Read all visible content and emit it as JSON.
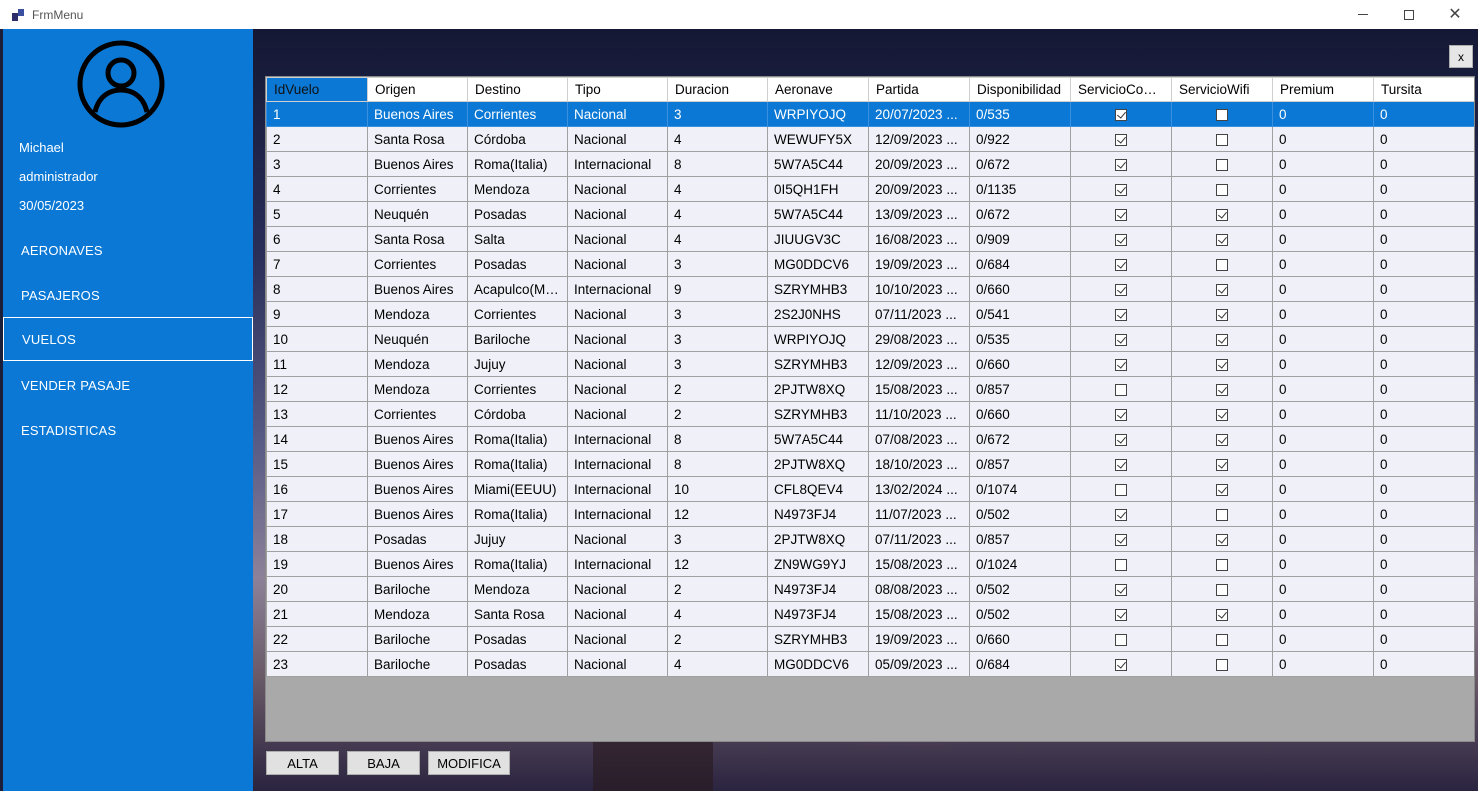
{
  "window": {
    "title": "FrmMenu"
  },
  "user": {
    "name": "Michael",
    "role": "administrador",
    "date": "30/05/2023"
  },
  "nav": [
    {
      "label": "AERONAVES",
      "active": false
    },
    {
      "label": "PASAJEROS",
      "active": false
    },
    {
      "label": "VUELOS",
      "active": true
    },
    {
      "label": "VENDER PASAJE",
      "active": false
    },
    {
      "label": "ESTADISTICAS",
      "active": false
    }
  ],
  "content": {
    "close_label": "x"
  },
  "grid": {
    "columns": [
      "IdVuelo",
      "Origen",
      "Destino",
      "Tipo",
      "Duracion",
      "Aeronave",
      "Partida",
      "Disponibilidad",
      "ServicioComida",
      "ServicioWifi",
      "Premium",
      "Tursita"
    ],
    "selected_row": 0,
    "rows": [
      [
        "1",
        "Buenos Aires",
        "Corrientes",
        "Nacional",
        "3",
        "WRPIYOJQ",
        "20/07/2023 ...",
        "0/535",
        true,
        false,
        "0",
        "0"
      ],
      [
        "2",
        "Santa Rosa",
        "Córdoba",
        "Nacional",
        "4",
        "WEWUFY5X",
        "12/09/2023 ...",
        "0/922",
        true,
        false,
        "0",
        "0"
      ],
      [
        "3",
        "Buenos Aires",
        "Roma(Italia)",
        "Internacional",
        "8",
        "5W7A5C44",
        "20/09/2023 ...",
        "0/672",
        true,
        false,
        "0",
        "0"
      ],
      [
        "4",
        "Corrientes",
        "Mendoza",
        "Nacional",
        "4",
        "0I5QH1FH",
        "20/09/2023 ...",
        "0/1135",
        true,
        false,
        "0",
        "0"
      ],
      [
        "5",
        "Neuquén",
        "Posadas",
        "Nacional",
        "4",
        "5W7A5C44",
        "13/09/2023 ...",
        "0/672",
        true,
        true,
        "0",
        "0"
      ],
      [
        "6",
        "Santa Rosa",
        "Salta",
        "Nacional",
        "4",
        "JIUUGV3C",
        "16/08/2023 ...",
        "0/909",
        true,
        true,
        "0",
        "0"
      ],
      [
        "7",
        "Corrientes",
        "Posadas",
        "Nacional",
        "3",
        "MG0DDCV6",
        "19/09/2023 ...",
        "0/684",
        true,
        false,
        "0",
        "0"
      ],
      [
        "8",
        "Buenos Aires",
        "Acapulco(Mé...",
        "Internacional",
        "9",
        "SZRYMHB3",
        "10/10/2023 ...",
        "0/660",
        true,
        true,
        "0",
        "0"
      ],
      [
        "9",
        "Mendoza",
        "Corrientes",
        "Nacional",
        "3",
        "2S2J0NHS",
        "07/11/2023 ...",
        "0/541",
        true,
        true,
        "0",
        "0"
      ],
      [
        "10",
        "Neuquén",
        "Bariloche",
        "Nacional",
        "3",
        "WRPIYOJQ",
        "29/08/2023 ...",
        "0/535",
        true,
        true,
        "0",
        "0"
      ],
      [
        "11",
        "Mendoza",
        "Jujuy",
        "Nacional",
        "3",
        "SZRYMHB3",
        "12/09/2023 ...",
        "0/660",
        true,
        true,
        "0",
        "0"
      ],
      [
        "12",
        "Mendoza",
        "Corrientes",
        "Nacional",
        "2",
        "2PJTW8XQ",
        "15/08/2023 ...",
        "0/857",
        false,
        true,
        "0",
        "0"
      ],
      [
        "13",
        "Corrientes",
        "Córdoba",
        "Nacional",
        "2",
        "SZRYMHB3",
        "11/10/2023 ...",
        "0/660",
        true,
        true,
        "0",
        "0"
      ],
      [
        "14",
        "Buenos Aires",
        "Roma(Italia)",
        "Internacional",
        "8",
        "5W7A5C44",
        "07/08/2023 ...",
        "0/672",
        true,
        true,
        "0",
        "0"
      ],
      [
        "15",
        "Buenos Aires",
        "Roma(Italia)",
        "Internacional",
        "8",
        "2PJTW8XQ",
        "18/10/2023 ...",
        "0/857",
        true,
        true,
        "0",
        "0"
      ],
      [
        "16",
        "Buenos Aires",
        "Miami(EEUU)",
        "Internacional",
        "10",
        "CFL8QEV4",
        "13/02/2024 ...",
        "0/1074",
        false,
        true,
        "0",
        "0"
      ],
      [
        "17",
        "Buenos Aires",
        "Roma(Italia)",
        "Internacional",
        "12",
        "N4973FJ4",
        "11/07/2023 ...",
        "0/502",
        true,
        false,
        "0",
        "0"
      ],
      [
        "18",
        "Posadas",
        "Jujuy",
        "Nacional",
        "3",
        "2PJTW8XQ",
        "07/11/2023 ...",
        "0/857",
        true,
        true,
        "0",
        "0"
      ],
      [
        "19",
        "Buenos Aires",
        "Roma(Italia)",
        "Internacional",
        "12",
        "ZN9WG9YJ",
        "15/08/2023 ...",
        "0/1024",
        false,
        false,
        "0",
        "0"
      ],
      [
        "20",
        "Bariloche",
        "Mendoza",
        "Nacional",
        "2",
        "N4973FJ4",
        "08/08/2023 ...",
        "0/502",
        true,
        false,
        "0",
        "0"
      ],
      [
        "21",
        "Mendoza",
        "Santa Rosa",
        "Nacional",
        "4",
        "N4973FJ4",
        "15/08/2023 ...",
        "0/502",
        true,
        true,
        "0",
        "0"
      ],
      [
        "22",
        "Bariloche",
        "Posadas",
        "Nacional",
        "2",
        "SZRYMHB3",
        "19/09/2023 ...",
        "0/660",
        false,
        false,
        "0",
        "0"
      ],
      [
        "23",
        "Bariloche",
        "Posadas",
        "Nacional",
        "4",
        "MG0DDCV6",
        "05/09/2023 ...",
        "0/684",
        true,
        false,
        "0",
        "0"
      ]
    ]
  },
  "buttons": {
    "alta": "ALTA",
    "baja": "BAJA",
    "modifica": "MODIFICA"
  },
  "colors": {
    "accent": "#0a78d4",
    "sidebar": "#0a78d4"
  }
}
